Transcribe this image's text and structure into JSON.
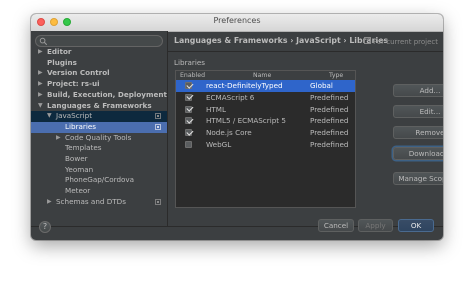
{
  "window": {
    "title": "Preferences"
  },
  "sidebar": {
    "search_placeholder": "",
    "items": [
      {
        "label": "Editor",
        "arrow": "▶",
        "bold": true
      },
      {
        "label": "Plugins",
        "arrow": "",
        "bold": true
      },
      {
        "label": "Version Control",
        "arrow": "▶",
        "bold": true
      },
      {
        "label": "Project: rs-ui",
        "arrow": "▶",
        "bold": true
      },
      {
        "label": "Build, Execution, Deployment",
        "arrow": "▶",
        "bold": true
      },
      {
        "label": "Languages & Frameworks",
        "arrow": "▼",
        "bold": true
      },
      {
        "label": "JavaScript",
        "arrow": "▼",
        "bold": false
      },
      {
        "label": "Libraries",
        "arrow": "",
        "bold": false
      },
      {
        "label": "Code Quality Tools",
        "arrow": "▶",
        "bold": false
      },
      {
        "label": "Templates",
        "arrow": "",
        "bold": false
      },
      {
        "label": "Bower",
        "arrow": "",
        "bold": false
      },
      {
        "label": "Yeoman",
        "arrow": "",
        "bold": false
      },
      {
        "label": "PhoneGap/Cordova",
        "arrow": "",
        "bold": false
      },
      {
        "label": "Meteor",
        "arrow": "",
        "bold": false
      },
      {
        "label": "Schemas and DTDs",
        "arrow": "▶",
        "bold": false
      }
    ]
  },
  "header": {
    "breadcrumb": "Languages & Frameworks › JavaScript › Libraries",
    "note": "For current project"
  },
  "libraries": {
    "section_label": "Libraries",
    "columns": [
      "Enabled",
      "Name",
      "Type"
    ],
    "rows": [
      {
        "enabled": true,
        "name": "react-DefinitelyTyped",
        "type": "Global"
      },
      {
        "enabled": true,
        "name": "ECMAScript 6",
        "type": "Predefined"
      },
      {
        "enabled": true,
        "name": "HTML",
        "type": "Predefined"
      },
      {
        "enabled": true,
        "name": "HTML5 / ECMAScript 5",
        "type": "Predefined"
      },
      {
        "enabled": true,
        "name": "Node.js Core",
        "type": "Predefined"
      },
      {
        "enabled": false,
        "name": "WebGL",
        "type": "Predefined"
      }
    ]
  },
  "buttons": {
    "add": "Add...",
    "edit": "Edit...",
    "remove": "Remove",
    "download": "Download...",
    "manage_scopes": "Manage Scopes..."
  },
  "footer": {
    "help": "?",
    "cancel": "Cancel",
    "apply": "Apply",
    "ok": "OK"
  },
  "colors": {
    "window_bg": "#3c3f41",
    "selection": "#4b6eaf",
    "table_selection": "#2f65ca",
    "text": "#bbbbbb"
  }
}
